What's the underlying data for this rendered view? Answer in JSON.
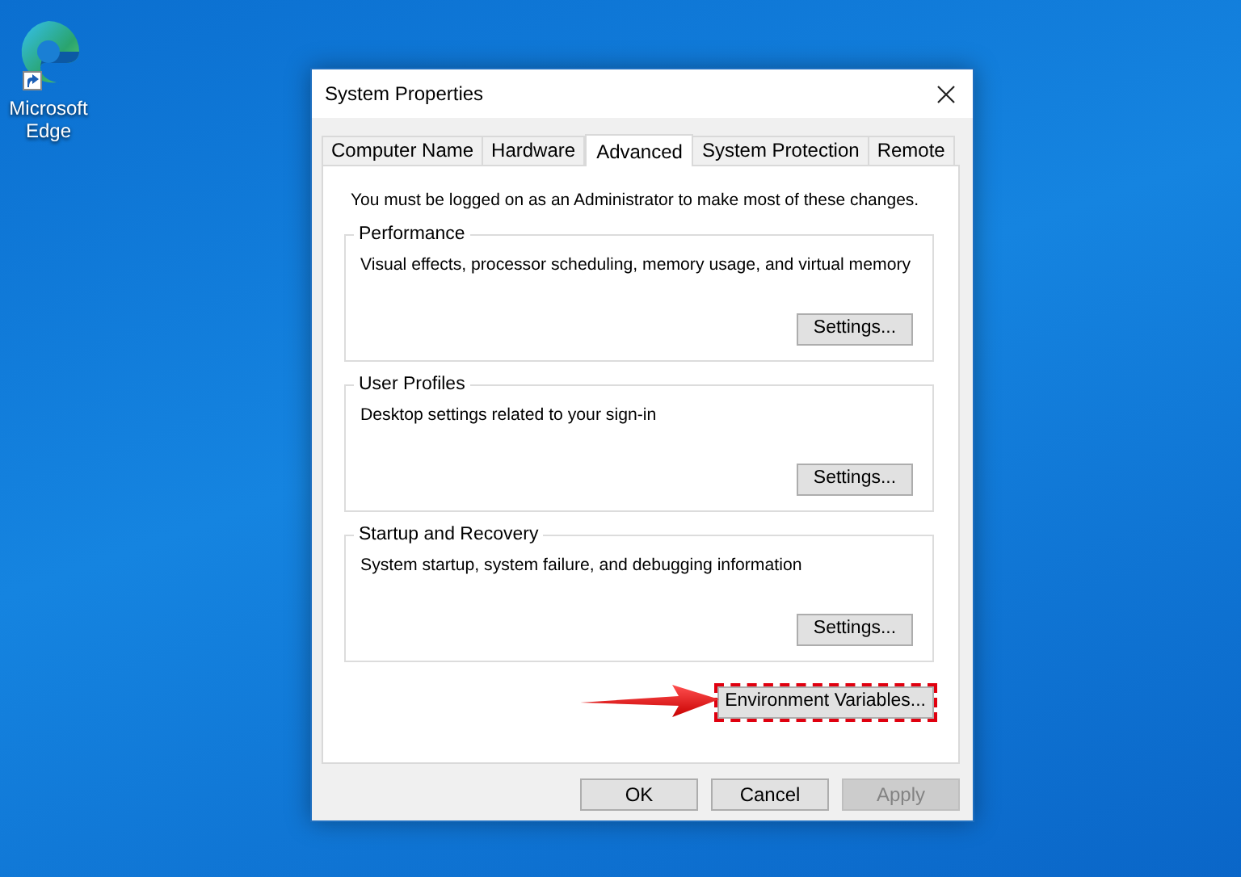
{
  "desktop_icons": [
    {
      "label": "Microsoft Edge"
    }
  ],
  "window": {
    "title": "System Properties",
    "tabs": [
      {
        "label": "Computer Name",
        "selected": false
      },
      {
        "label": "Hardware",
        "selected": false
      },
      {
        "label": "Advanced",
        "selected": true
      },
      {
        "label": "System Protection",
        "selected": false
      },
      {
        "label": "Remote",
        "selected": false
      }
    ],
    "notice": "You must be logged on as an Administrator to make most of these changes.",
    "groups": [
      {
        "title": "Performance",
        "description": "Visual effects, processor scheduling, memory usage, and virtual memory",
        "button": "Settings..."
      },
      {
        "title": "User Profiles",
        "description": "Desktop settings related to your sign-in",
        "button": "Settings..."
      },
      {
        "title": "Startup and Recovery",
        "description": "System startup, system failure, and debugging information",
        "button": "Settings..."
      }
    ],
    "environment_button": {
      "label": "Environment Variables...",
      "highlighted": true
    },
    "footer_buttons": [
      {
        "label": "OK",
        "disabled": false
      },
      {
        "label": "Cancel",
        "disabled": false
      },
      {
        "label": "Apply",
        "disabled": true
      }
    ]
  }
}
